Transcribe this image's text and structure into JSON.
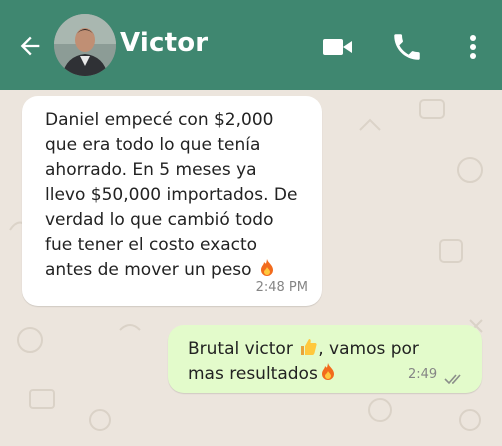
{
  "header": {
    "contact_name": "Victor",
    "icons": [
      "back-arrow-icon",
      "avatar",
      "video-call-icon",
      "phone-icon",
      "more-options-icon"
    ],
    "background_color": "#3F8770"
  },
  "messages": [
    {
      "direction": "incoming",
      "text": "Daniel empecé con $2,000\nque era todo lo que tenía\nahorrado. En 5 meses ya\nllevo $50,000 importados. De\nverdad lo que cambió todo\nfue tener el costo exacto\nantes de mover un peso",
      "emoji": "fire",
      "time": "2:48 PM"
    },
    {
      "direction": "outgoing",
      "line1": "Brutal victor",
      "emoji1": "thumbs-up",
      "line1_end": ", vamos por",
      "line2": "mas resultados",
      "emoji2": "fire",
      "time": "2:49",
      "status": "read"
    }
  ],
  "colors": {
    "incoming_bubble": "#FFFFFF",
    "outgoing_bubble": "#E3FBCB",
    "chat_background": "#ECE5DD"
  }
}
